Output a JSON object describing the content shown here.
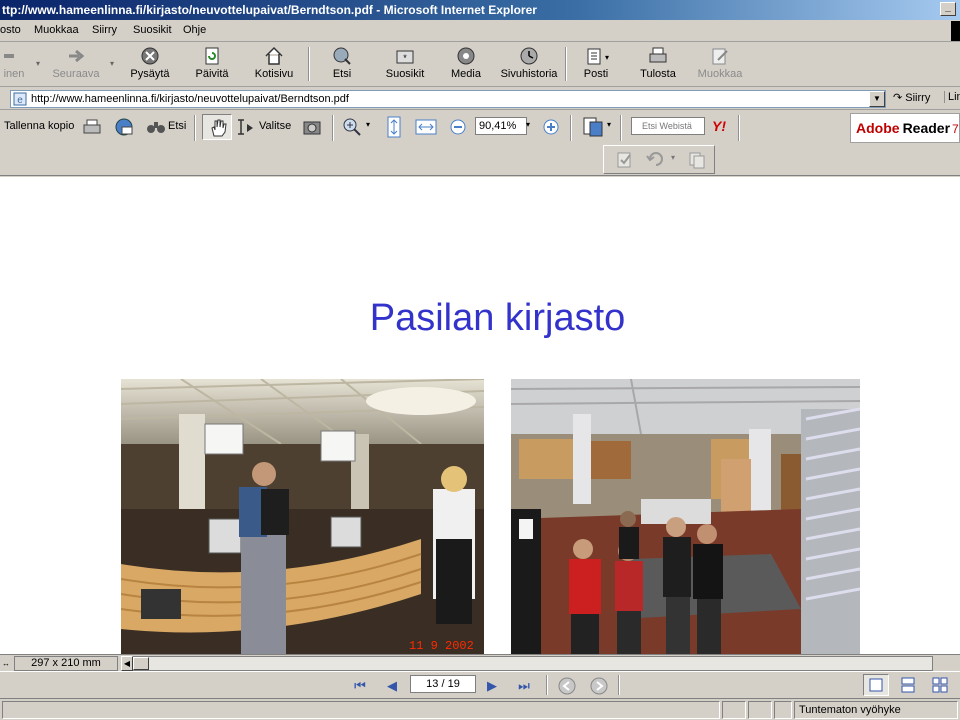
{
  "window": {
    "title": "ttp://www.hameenlinna.fi/kirjasto/neuvottelupaivat/Berndtson.pdf - Microsoft Internet Explorer"
  },
  "menu": [
    "osto",
    "Muokkaa",
    "Siirry",
    "Suosikit",
    "Ohje"
  ],
  "toolbar": {
    "back": "inen",
    "forward": "Seuraava",
    "stop": "Pysäytä",
    "refresh": "Päivitä",
    "home": "Kotisivu",
    "search": "Etsi",
    "favorites": "Suosikit",
    "media": "Media",
    "history": "Sivuhistoria",
    "mail": "Posti",
    "print": "Tulosta",
    "edit": "Muokkaa"
  },
  "address": {
    "url": "http://www.hameenlinna.fi/kirjasto/neuvottelupaivat/Berndtson.pdf",
    "go": "Siirry",
    "links": "Lin"
  },
  "reader": {
    "save_copy": "Tallenna kopio",
    "find": "Etsi",
    "select": "Valitse",
    "zoom": "90,41%",
    "search_web": "Etsi Webistä",
    "yahoo": "Y!",
    "logo_adobe": "Adobe",
    "logo_reader": "Reader",
    "logo_version": "7"
  },
  "document": {
    "title": "Pasilan kirjasto",
    "photo_date": "11   9 2002",
    "page_size": "297 x 210 mm"
  },
  "navigation": {
    "page": "13 / 19"
  },
  "status": {
    "zone": "Tuntematon vyöhyke"
  }
}
